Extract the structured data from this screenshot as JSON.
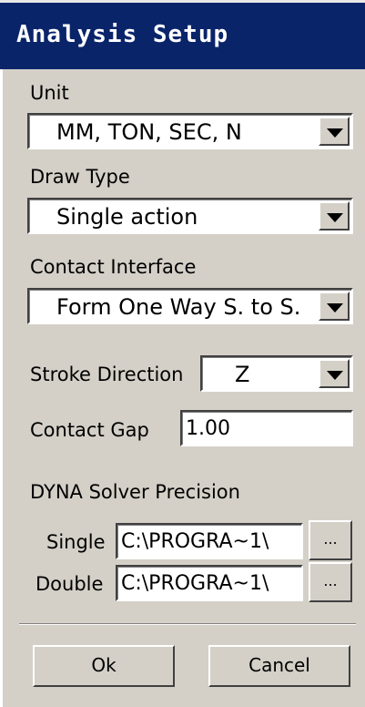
{
  "window": {
    "title": "Analysis Setup"
  },
  "unit": {
    "label": "Unit",
    "value": "MM, TON, SEC, N"
  },
  "draw_type": {
    "label": "Draw Type",
    "value": "Single action"
  },
  "contact_interface": {
    "label": "Contact Interface",
    "value": "Form One Way S. to S."
  },
  "stroke_direction": {
    "label": "Stroke Direction",
    "value": "Z"
  },
  "contact_gap": {
    "label": "Contact Gap",
    "value": "1.00"
  },
  "solver": {
    "heading": "DYNA Solver Precision",
    "single": {
      "label": "Single",
      "path": "C:\\PROGRA~1\\",
      "browse": "..."
    },
    "double": {
      "label": "Double",
      "path": "C:\\PROGRA~1\\",
      "browse": "..."
    }
  },
  "buttons": {
    "ok": "Ok",
    "cancel": "Cancel"
  }
}
